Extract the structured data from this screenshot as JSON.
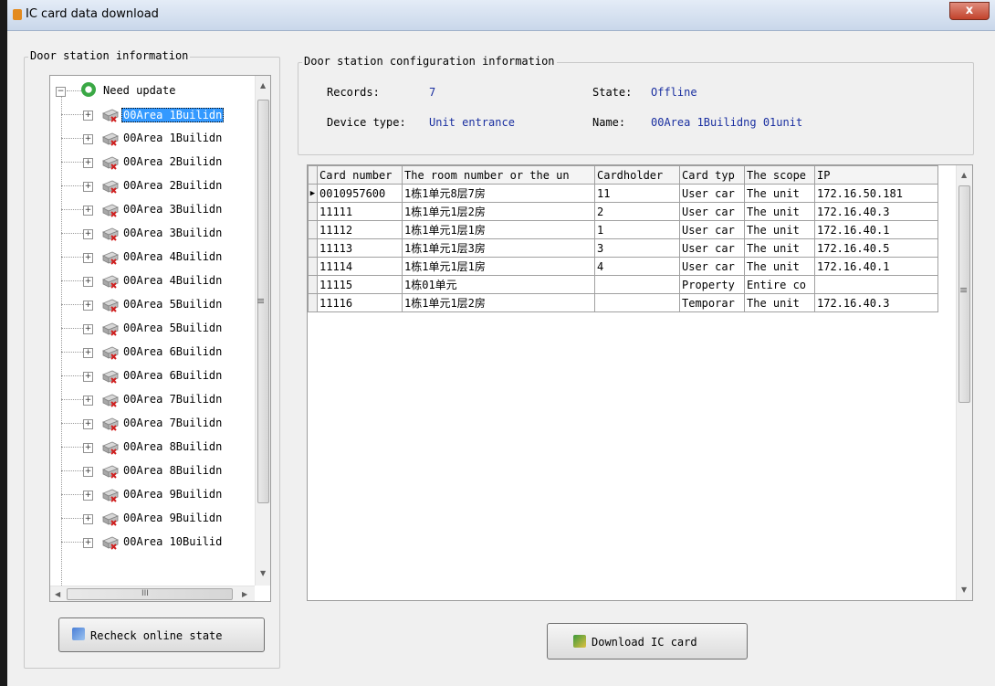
{
  "window": {
    "title": "IC card data download",
    "close_label": "x"
  },
  "left_panel": {
    "group_label": "Door station information",
    "root": {
      "label": "Need update",
      "expander": "−"
    },
    "items": [
      {
        "label": "00Area 1Builidn",
        "selected": true
      },
      {
        "label": "00Area 1Builidn"
      },
      {
        "label": "00Area 2Builidn"
      },
      {
        "label": "00Area 2Builidn"
      },
      {
        "label": "00Area 3Builidn"
      },
      {
        "label": "00Area 3Builidn"
      },
      {
        "label": "00Area 4Builidn"
      },
      {
        "label": "00Area 4Builidn"
      },
      {
        "label": "00Area 5Builidn"
      },
      {
        "label": "00Area 5Builidn"
      },
      {
        "label": "00Area 6Builidn"
      },
      {
        "label": "00Area 6Builidn"
      },
      {
        "label": "00Area 7Builidn"
      },
      {
        "label": "00Area 7Builidn"
      },
      {
        "label": "00Area 8Builidn"
      },
      {
        "label": "00Area 8Builidn"
      },
      {
        "label": "00Area 9Builidn"
      },
      {
        "label": "00Area 9Builidn"
      },
      {
        "label": "00Area 10Builid"
      }
    ],
    "expander_symbol": "+",
    "recheck_button": "Recheck online state"
  },
  "config": {
    "group_label": "Door station configuration information",
    "records_label": "Records:",
    "records_value": "7",
    "state_label": "State:",
    "state_value": "Offline",
    "device_type_label": "Device type:",
    "device_type_value": "Unit entrance",
    "name_label": "Name:",
    "name_value": "00Area 1Builidng 01unit"
  },
  "table": {
    "columns": [
      "Card number",
      "The room number or the un",
      "Cardholder",
      "Card typ",
      "The scope",
      "IP"
    ],
    "rows": [
      [
        "0010957600",
        "1栋1单元8层7房",
        "11",
        "User car",
        "The unit",
        "172.16.50.181"
      ],
      [
        "11111",
        "1栋1单元1层2房",
        "2",
        "User car",
        "The unit",
        "172.16.40.3"
      ],
      [
        "11112",
        "1栋1单元1层1房",
        "1",
        "User car",
        "The unit",
        "172.16.40.1"
      ],
      [
        "11113",
        "1栋1单元1层3房",
        "3",
        "User car",
        "The unit",
        "172.16.40.5"
      ],
      [
        "11114",
        "1栋1单元1层1房",
        "4",
        "User car",
        "The unit",
        "172.16.40.1"
      ],
      [
        "11115",
        "1栋01单元",
        "",
        "Property",
        "Entire co",
        ""
      ],
      [
        "11116",
        "1栋1单元1层2房",
        "",
        "Temporar",
        "The unit",
        "172.16.40.3"
      ]
    ],
    "current_row_marker": "▶"
  },
  "download_button": "Download IC card",
  "scroll_glyphs": {
    "up": "▲",
    "down": "▼",
    "left": "◀",
    "right": "▶",
    "grip": "≡",
    "hgrip": "III"
  }
}
